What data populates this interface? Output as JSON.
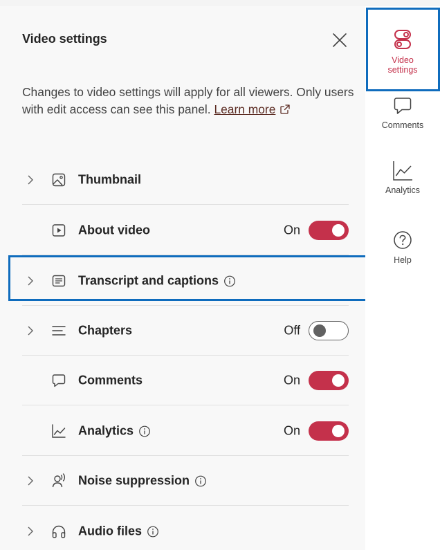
{
  "panel": {
    "title": "Video settings",
    "description": "Changes to video settings will apply for all viewers. Only users with edit access can see this panel.",
    "learn_more": "Learn more"
  },
  "rows": [
    {
      "label": "Thumbnail",
      "icon": "image-icon",
      "expandable": true
    },
    {
      "label": "About video",
      "icon": "play-box-icon",
      "expandable": false,
      "state": "On",
      "toggle": true
    },
    {
      "label": "Transcript and captions",
      "icon": "transcript-icon",
      "expandable": true,
      "info": true
    },
    {
      "label": "Chapters",
      "icon": "list-lines-icon",
      "expandable": true,
      "state": "Off",
      "toggle": false
    },
    {
      "label": "Comments",
      "icon": "comment-icon",
      "expandable": false,
      "state": "On",
      "toggle": true
    },
    {
      "label": "Analytics",
      "icon": "chart-line-icon",
      "expandable": false,
      "state": "On",
      "toggle": true,
      "info": true
    },
    {
      "label": "Noise suppression",
      "icon": "noise-suppression-icon",
      "expandable": true,
      "info": true
    },
    {
      "label": "Audio files",
      "icon": "headphones-icon",
      "expandable": true,
      "info": true
    }
  ],
  "rail": [
    {
      "label_line1": "Video",
      "label_line2": "settings",
      "icon": "settings-toggle-icon",
      "active": true
    },
    {
      "label": "Comments",
      "icon": "comment-icon"
    },
    {
      "label": "Analytics",
      "icon": "chart-line-icon"
    },
    {
      "label": "Help",
      "icon": "help-circle-icon"
    }
  ],
  "colors": {
    "accent": "#c4314b",
    "focus": "#0f6cbd",
    "panel_bg": "#f8f8f8"
  }
}
